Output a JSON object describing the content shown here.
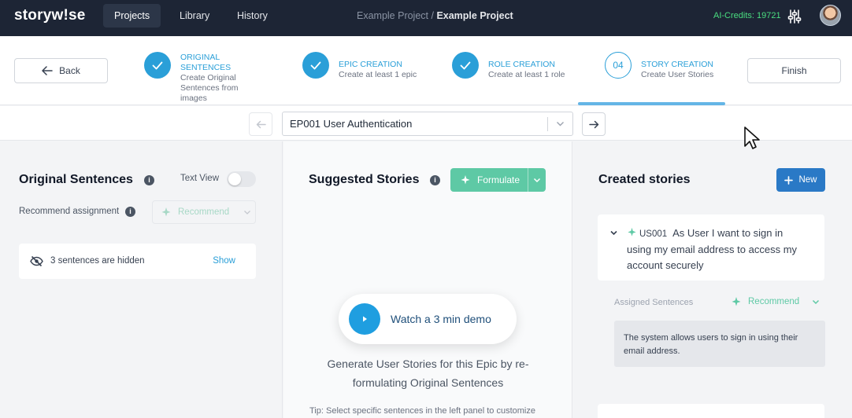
{
  "app": {
    "logo": "storyw!se"
  },
  "nav": {
    "items": [
      {
        "label": "Projects"
      },
      {
        "label": "Library"
      },
      {
        "label": "History"
      }
    ],
    "breadcrumb_project": "Example Project",
    "breadcrumb_sep": " / ",
    "breadcrumb_current": "Example Project",
    "credits": "AI-Credits: 19721",
    "settings_icon": "sliders-icon",
    "avatar": "user-avatar"
  },
  "stepper": {
    "back_label": "Back",
    "finish_label": "Finish",
    "steps": [
      {
        "title": "ORIGINAL SENTENCES",
        "subtitle": "Create Original Sentences from images",
        "state": "done"
      },
      {
        "title": "EPIC CREATION",
        "subtitle": "Create at least 1 epic",
        "state": "done"
      },
      {
        "title": "ROLE CREATION",
        "subtitle": "Create at least 1 role",
        "state": "done"
      },
      {
        "number": "04",
        "title": "STORY CREATION",
        "subtitle": "Create User Stories",
        "state": "active"
      }
    ]
  },
  "epic_selector": {
    "value": "EP001 User Authentication"
  },
  "left_panel": {
    "title": "Original Sentences",
    "text_view_label": "Text View",
    "text_view_on": false,
    "recommend_assignment_label": "Recommend assignment",
    "recommend_label": "Recommend",
    "hidden_text": "3 sentences are hidden",
    "show_label": "Show"
  },
  "middle_panel": {
    "title": "Suggested Stories",
    "formulate_label": "Formulate",
    "demo_label": "Watch a 3 min demo",
    "generate_text": "Generate User Stories for this Epic by re-formulating Original Sentences",
    "tip_text": "Tip: Select specific sentences in the left panel to customize"
  },
  "right_panel": {
    "title": "Created stories",
    "new_label": "New",
    "stories": [
      {
        "id": "US001",
        "text": "As User I want to sign in using my email address to access my account securely"
      }
    ],
    "assigned_label": "Assigned Sentences",
    "recommend_label": "Recommend",
    "assigned_sentence": "The system allows users to sign in using their email address."
  },
  "colors": {
    "accent": "#2a9fd8",
    "green": "#5ec9a5",
    "nav_bg": "#1d2535",
    "primary_btn": "#2a79c6"
  }
}
